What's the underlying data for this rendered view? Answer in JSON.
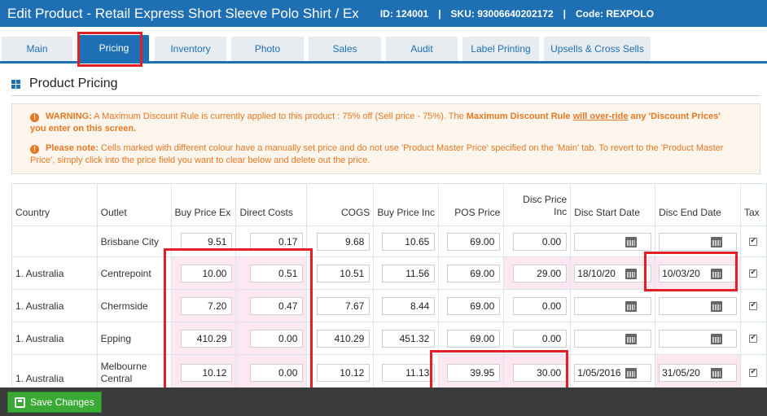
{
  "header": {
    "title": "Edit Product - Retail Express Short Sleeve Polo Shirt / Ex",
    "id": "ID: 124001",
    "sku": "SKU: 93006640202172",
    "code": "Code: REXPOLO",
    "sep": "|"
  },
  "tabs": [
    {
      "label": "Main"
    },
    {
      "label": "Pricing"
    },
    {
      "label": "Inventory"
    },
    {
      "label": "Photo"
    },
    {
      "label": "Sales"
    },
    {
      "label": "Audit"
    },
    {
      "label": "Label Printing"
    },
    {
      "label": "Upsells & Cross Sells"
    }
  ],
  "section": {
    "title": "Product Pricing"
  },
  "warning": {
    "w1_label": "WARNING:",
    "w1_text": " A Maximum Discount Rule is currently applied to this product : 75% off (Sell price - 75%). The ",
    "w1_bold1": "Maximum Discount Rule",
    "w1_ul": "will over-ride",
    "w1_bold2": "any 'Discount Prices'",
    "w1_tail": "you enter on this screen.",
    "w2_label": "Please note:",
    "w2_text": " Cells marked with different colour have a manually set price and do not use 'Product Master Price' specified on the 'Main' tab. To revert to the 'Product Master Price', simply click into the price field you want to clear below and delete out the price."
  },
  "table": {
    "columns": [
      "Country",
      "Outlet",
      "Buy Price Ex",
      "Direct Costs",
      "COGS",
      "Buy Price Inc",
      "POS Price",
      "Disc Price Inc",
      "Disc Start Date",
      "Disc End Date",
      "Tax"
    ],
    "disc_price_l1": "Disc Price",
    "disc_price_l2": "Inc",
    "rows": [
      {
        "country": "",
        "outlet": "Brisbane City",
        "buy_ex": "9.51",
        "direct": "0.17",
        "cogs": "9.68",
        "buy_inc": "10.65",
        "pos": "69.00",
        "disc": "0.00",
        "start": "",
        "end": ""
      },
      {
        "country": "1. Australia",
        "outlet": "Centrepoint",
        "buy_ex": "10.00",
        "direct": "0.51",
        "cogs": "10.51",
        "buy_inc": "11.56",
        "pos": "69.00",
        "disc": "29.00",
        "start": "18/10/20",
        "end": "10/03/20"
      },
      {
        "country": "1. Australia",
        "outlet": "Chermside",
        "buy_ex": "7.20",
        "direct": "0.47",
        "cogs": "7.67",
        "buy_inc": "8.44",
        "pos": "69.00",
        "disc": "0.00",
        "start": "",
        "end": ""
      },
      {
        "country": "1. Australia",
        "outlet": "Epping",
        "buy_ex": "410.29",
        "direct": "0.00",
        "cogs": "410.29",
        "buy_inc": "451.32",
        "pos": "69.00",
        "disc": "0.00",
        "start": "",
        "end": ""
      },
      {
        "country": "1. Australia",
        "outlet_l1": "Melbourne",
        "outlet_l2": "Central",
        "buy_ex": "10.12",
        "direct": "0.00",
        "cogs": "10.12",
        "buy_inc": "11.13",
        "pos": "39.95",
        "disc": "30.00",
        "start": "1/05/2016",
        "end": "31/05/20"
      }
    ]
  },
  "footer": {
    "save_label": "Save Changes"
  },
  "colors": {
    "brand": "#1e6fb3",
    "warning": "#e87722",
    "manual_cell": "#fde8f1",
    "highlight": "#e31e24",
    "save": "#3aa935"
  }
}
